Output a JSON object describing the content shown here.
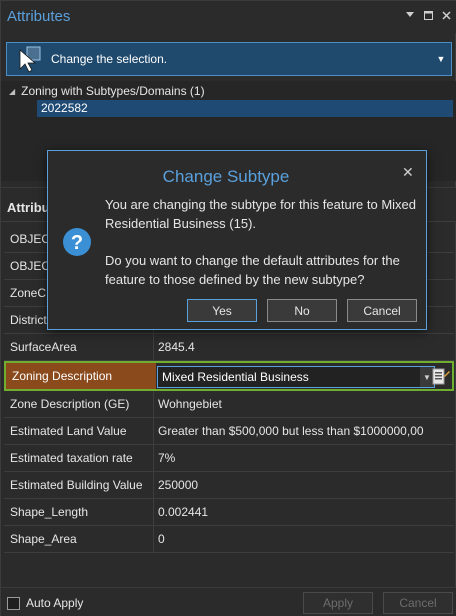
{
  "pane": {
    "title": "Attributes",
    "icons": [
      "chevron-down-icon",
      "maximize-icon",
      "close-icon"
    ]
  },
  "selection": {
    "label": "Change the selection.",
    "icon": "cursor-select-icon"
  },
  "tree": {
    "layer_label": "Zoning with Subtypes/Domains (1)",
    "selected_feature": "2022582"
  },
  "attributes": {
    "header_label": "Attribu",
    "rows": [
      {
        "key": "OBJECT",
        "value": ""
      },
      {
        "key": "OBJECT",
        "value": ""
      },
      {
        "key": "ZoneC",
        "value": ""
      },
      {
        "key": "District",
        "value": ""
      },
      {
        "key": "SurfaceArea",
        "value": "2845.4"
      },
      {
        "key": "Zoning Description",
        "value": "Mixed Residential Business"
      },
      {
        "key": "Zone Description (GE)",
        "value": "Wohngebiet"
      },
      {
        "key": "Estimated Land Value",
        "value": "Greater than $500,000 but less than $1000000,00"
      },
      {
        "key": "Estimated taxation rate",
        "value": "7%"
      },
      {
        "key": "Estimated Building Value",
        "value": "250000"
      },
      {
        "key": "Shape_Length",
        "value": "0.002441"
      },
      {
        "key": "Shape_Area",
        "value": "0"
      }
    ]
  },
  "footer": {
    "auto_apply_label": "Auto Apply",
    "apply_label": "Apply",
    "cancel_label": "Cancel"
  },
  "dialog": {
    "title": "Change Subtype",
    "message_1": "You are changing the subtype for this feature to Mixed Residential Business (15).",
    "message_2": "Do you want to change the default attributes for the feature to those defined by the new subtype?",
    "yes_label": "Yes",
    "no_label": "No",
    "cancel_label": "Cancel",
    "icon": "question-icon"
  },
  "colors": {
    "accent": "#5aa0dc",
    "highlight_border": "#6fae2f",
    "changed_field": "#8a4a1c",
    "selection_bg": "#1f4a6e"
  }
}
